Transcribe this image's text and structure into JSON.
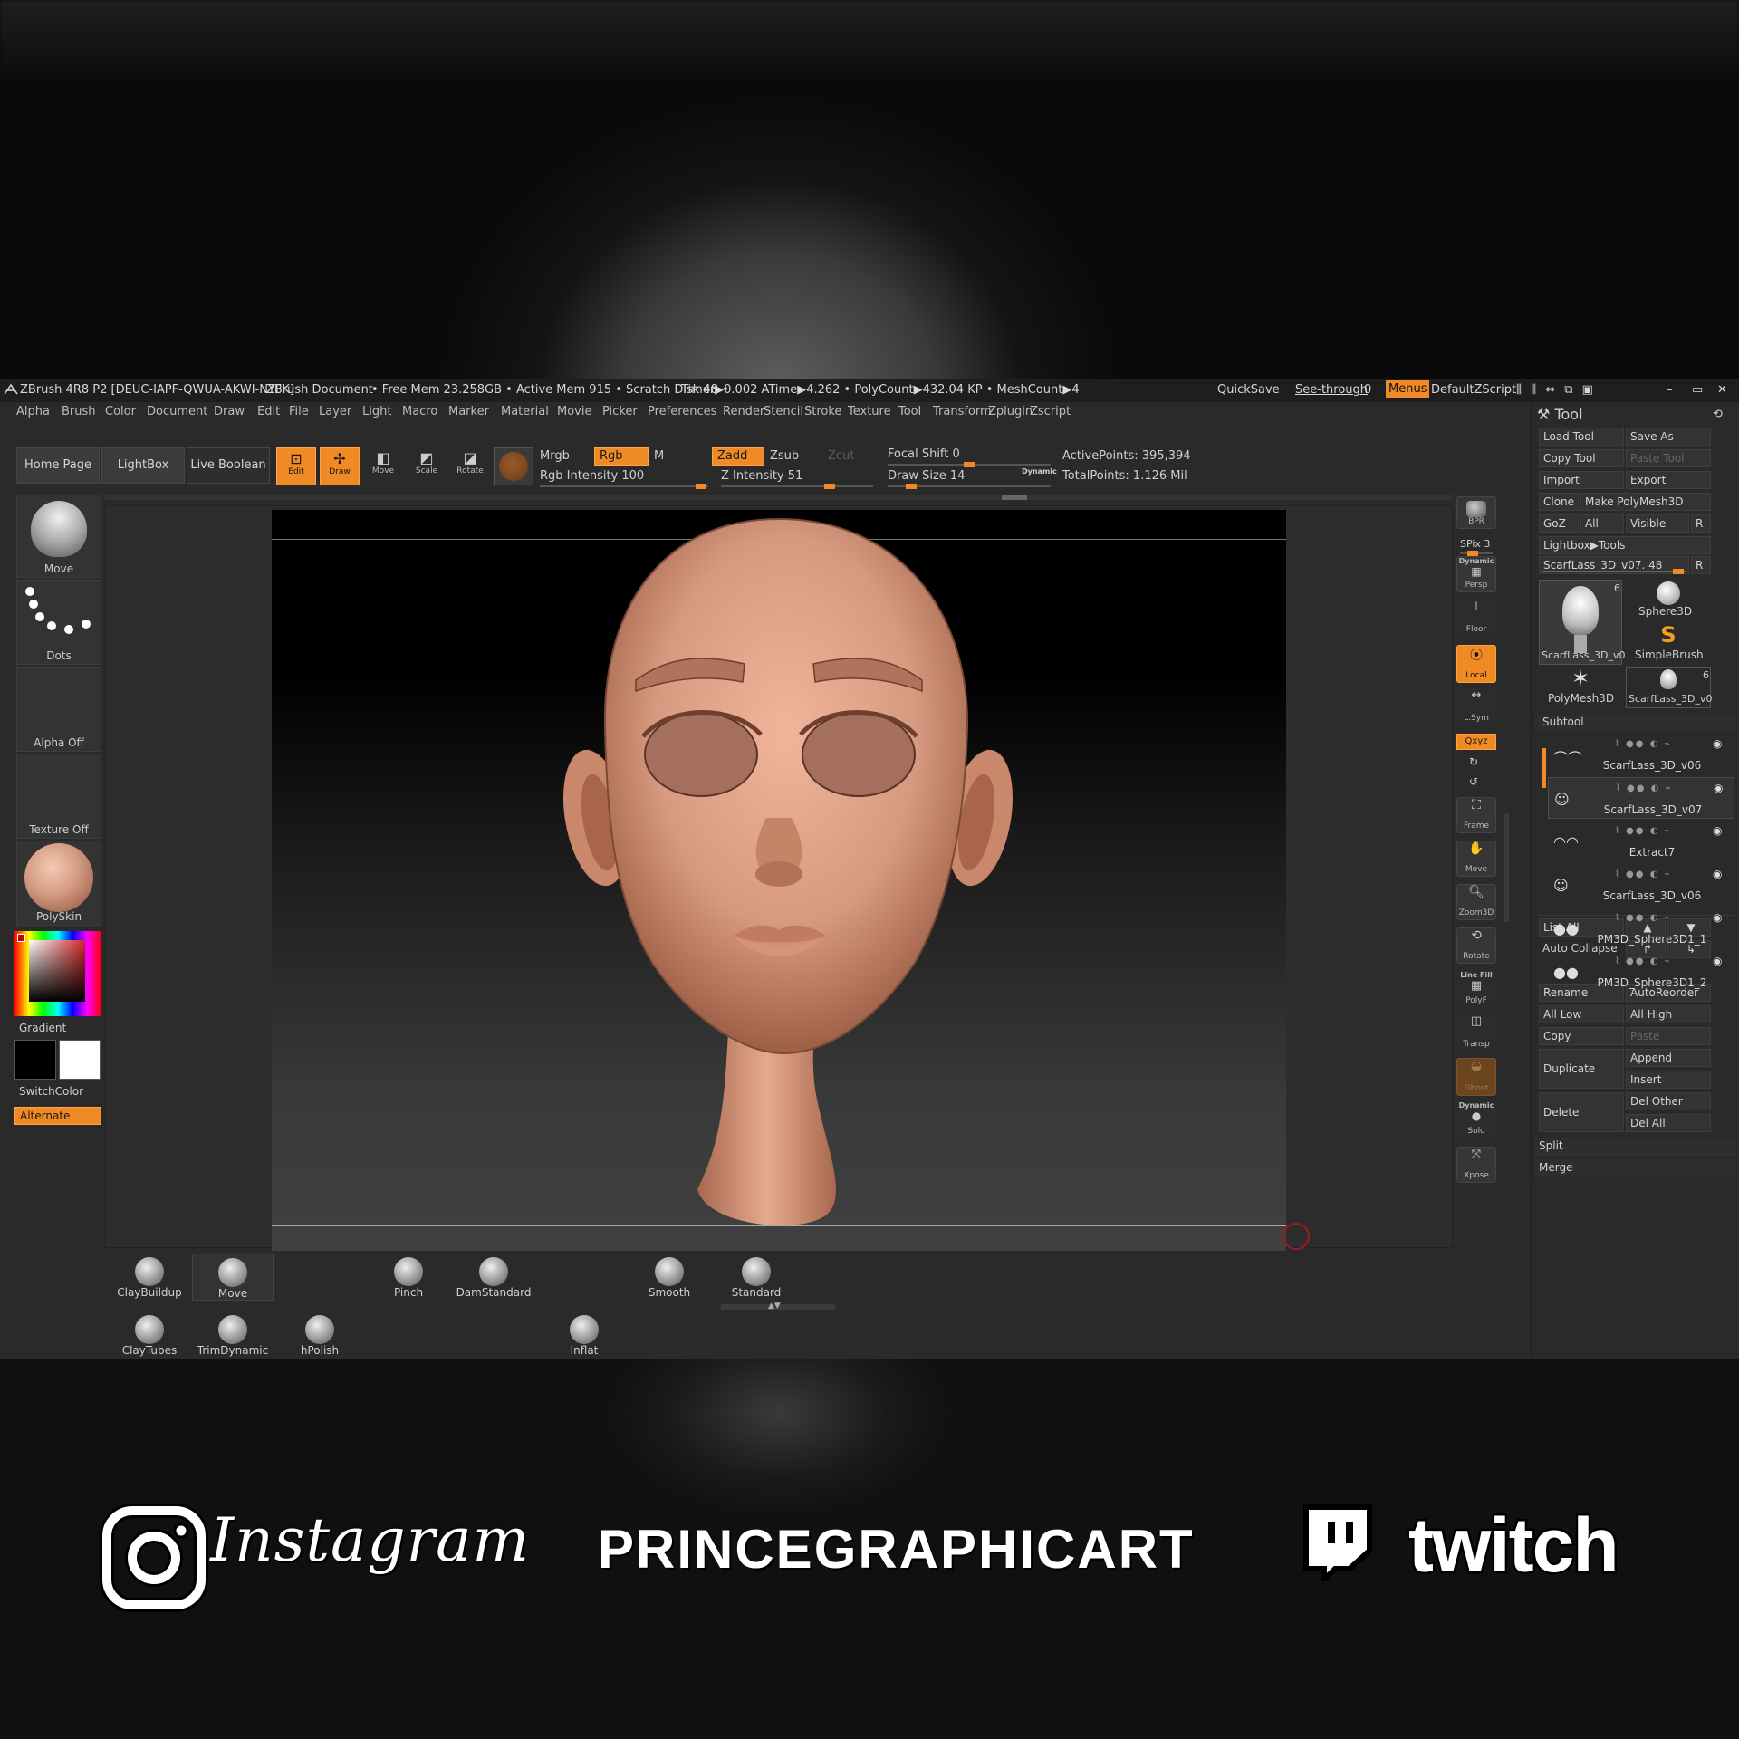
{
  "title_bar": {
    "app": "ZBrush 4R8 P2 [DEUC-IAPF-QWUA-AKWI-NYFK]",
    "document": "ZBrush Document",
    "stats": "• Free Mem 23.258GB • Active Mem 915 • Scratch Disk 48 •",
    "timer": "Timer▶0.002 ATime▶4.262 • PolyCount▶432.04 KP • MeshCount▶4",
    "quicksave": "QuickSave",
    "see_through": "See-through",
    "see_through_value": "0",
    "menus": "Menus",
    "script": "DefaultZScript"
  },
  "menu": [
    "Alpha",
    "Brush",
    "Color",
    "Document",
    "Draw",
    "Edit",
    "File",
    "Layer",
    "Light",
    "Macro",
    "Marker",
    "Material",
    "Movie",
    "Picker",
    "Preferences",
    "Render",
    "Stencil",
    "Stroke",
    "Texture",
    "Tool",
    "Transform",
    "Zplugin",
    "Zscript"
  ],
  "toolbar": {
    "home_page": "Home Page",
    "lightbox": "LightBox",
    "live_boolean": "Live Boolean",
    "edit": "Edit",
    "draw": "Draw",
    "move": "Move",
    "scale": "Scale",
    "rotate": "Rotate",
    "mrgb": "Mrgb",
    "rgb": "Rgb",
    "m": "M",
    "zadd": "Zadd",
    "zsub": "Zsub",
    "zcut": "Zcut",
    "rgb_intensity": "Rgb Intensity 100",
    "rgb_intensity_value": 100,
    "z_intensity": "Z Intensity 51",
    "z_intensity_value": 51,
    "focal_shift": "Focal Shift 0",
    "focal_shift_value": 0,
    "draw_size": "Draw Size 14",
    "draw_size_value": 14,
    "dynamic": "Dynamic",
    "active_points": "ActivePoints: 395,394",
    "total_points": "TotalPoints: 1.126 Mil"
  },
  "left_shelf": {
    "brush": "Move",
    "stroke": "Dots",
    "alpha": "Alpha Off",
    "texture": "Texture Off",
    "material": "PolySkin",
    "gradient": "Gradient",
    "switch_color": "SwitchColor",
    "alternate": "Alternate"
  },
  "right_icons": {
    "bpr": "BPR",
    "spix": "SPix 3",
    "persp": "Persp",
    "persp_top": "Dynamic",
    "floor": "Floor",
    "local": "Local",
    "lsym": "L.Sym",
    "xyz": "Qxyz",
    "frame": "Frame",
    "move": "Move",
    "zoom3d": "Zoom3D",
    "rotate": "Rotate",
    "linefill": "Line Fill",
    "polyf": "PolyF",
    "transp": "Transp",
    "ghost": "Ghost",
    "solo_top": "Dynamic",
    "solo": "Solo",
    "xpose": "Xpose"
  },
  "tool_panel": {
    "header": "Tool",
    "load_tool": "Load Tool",
    "save_as": "Save As",
    "copy_tool": "Copy Tool",
    "paste_tool": "Paste Tool",
    "import": "Import",
    "export": "Export",
    "clone": "Clone",
    "make_polymesh": "Make PolyMesh3D",
    "goz": "GoZ",
    "all": "All",
    "visible": "Visible",
    "r": "R",
    "lightbox_tools": "Lightbox▶Tools",
    "current_tool": "ScarfLass_3D_v07. 48",
    "thumbs": [
      {
        "name": "ScarfLass_3D_v0",
        "count": "6"
      },
      {
        "name": "Sphere3D",
        "count": ""
      },
      {
        "name": "SimpleBrush",
        "count": ""
      },
      {
        "name": "PolyMesh3D",
        "count": ""
      },
      {
        "name": "ScarfLass_3D_v0",
        "count": "6"
      }
    ],
    "subtool_header": "Subtool",
    "subtools": [
      "ScarfLass_3D_v06",
      "ScarfLass_3D_v07",
      "Extract7",
      "ScarfLass_3D_v06",
      "PM3D_Sphere3D1_1",
      "PM3D_Sphere3D1_2"
    ],
    "list_all": "List All",
    "auto_collapse": "Auto Collapse",
    "rename": "Rename",
    "auto_reorder": "AutoReorder",
    "all_low": "All Low",
    "all_high": "All High",
    "copy": "Copy",
    "paste": "Paste",
    "duplicate": "Duplicate",
    "append": "Append",
    "insert": "Insert",
    "delete": "Delete",
    "del_other": "Del Other",
    "del_all": "Del All",
    "split": "Split",
    "merge": "Merge"
  },
  "brushes_row1": [
    "ClayBuildup",
    "Move",
    "Pinch",
    "DamStandard",
    "Smooth",
    "Standard"
  ],
  "brushes_row2": [
    "ClayTubes",
    "TrimDynamic",
    "hPolish",
    "Inflat"
  ],
  "social": {
    "instagram": "Instagram",
    "channel": "PRINCEGRAPHICART",
    "twitch": "twitch"
  },
  "colors": {
    "accent": "#f08a24",
    "panel": "#2a2a2a",
    "skin": "#d39a80"
  }
}
